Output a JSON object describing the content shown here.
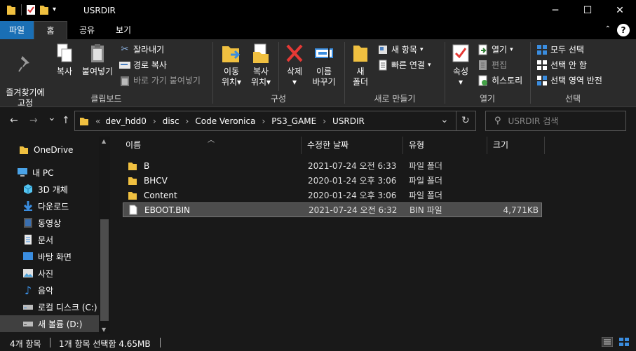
{
  "window": {
    "title": "USRDIR",
    "minimize": "─",
    "maximize": "☐",
    "close": "✕"
  },
  "ribbon_tabs": {
    "file": "파일",
    "home": "홈",
    "share": "공유",
    "view": "보기"
  },
  "clipboard": {
    "pin": "즐겨찾기에\n고정",
    "copy": "복사",
    "paste": "붙여넣기",
    "cut": "잘라내기",
    "copy_path": "경로 복사",
    "paste_shortcut": "바로 가기 붙여넣기",
    "label": "클립보드"
  },
  "organize": {
    "move_to": "이동\n위치",
    "copy_to": "복사\n위치",
    "delete": "삭제",
    "rename": "이름\n바꾸기",
    "label": "구성",
    "dd": "▾"
  },
  "new": {
    "new_folder": "새\n폴더",
    "new_item": "새 항목",
    "easy_access": "빠른 연결",
    "label": "새로 만들기"
  },
  "open": {
    "properties": "속성",
    "open": "열기",
    "edit": "편집",
    "history": "히스토리",
    "label": "열기"
  },
  "select": {
    "select_all": "모두 선택",
    "select_none": "선택 안 함",
    "invert": "선택 영역 반전",
    "label": "선택"
  },
  "nav": {
    "back": "←",
    "forward": "→",
    "recent": "⌄",
    "up": "↑",
    "refresh": "↻",
    "dropdown": "⌄"
  },
  "address": {
    "crumbs": [
      "«",
      "dev_hdd0",
      "disc",
      "Code Veronica",
      "PS3_GAME",
      "USRDIR"
    ]
  },
  "search": {
    "placeholder": "USRDIR 검색"
  },
  "sidebar": {
    "items": [
      {
        "label": "OneDrive"
      },
      {
        "label": "내 PC"
      },
      {
        "label": "3D 개체"
      },
      {
        "label": "다운로드"
      },
      {
        "label": "동영상"
      },
      {
        "label": "문서"
      },
      {
        "label": "바탕 화면"
      },
      {
        "label": "사진"
      },
      {
        "label": "음악"
      },
      {
        "label": "로컬 디스크 (C:)"
      },
      {
        "label": "새 볼륨 (D:)"
      }
    ]
  },
  "columns": {
    "name": "이름",
    "modified": "수정한 날짜",
    "type": "유형",
    "size": "크기"
  },
  "files": [
    {
      "name": "B",
      "modified": "2021-07-24 오전 6:33",
      "type": "파일 폴더",
      "size": ""
    },
    {
      "name": "BHCV",
      "modified": "2020-01-24 오후 3:06",
      "type": "파일 폴더",
      "size": ""
    },
    {
      "name": "Content",
      "modified": "2020-01-24 오후 3:06",
      "type": "파일 폴더",
      "size": ""
    },
    {
      "name": "EBOOT.BIN",
      "modified": "2021-07-24 오전 6:32",
      "type": "BIN 파일",
      "size": "4,771KB"
    }
  ],
  "status": {
    "count": "4개 항목",
    "selected": "1개 항목 선택함 4.65MB"
  },
  "colors": {
    "folder": "#f0c040",
    "accent": "#1a6fb5",
    "selection": "#4d4d4d"
  }
}
